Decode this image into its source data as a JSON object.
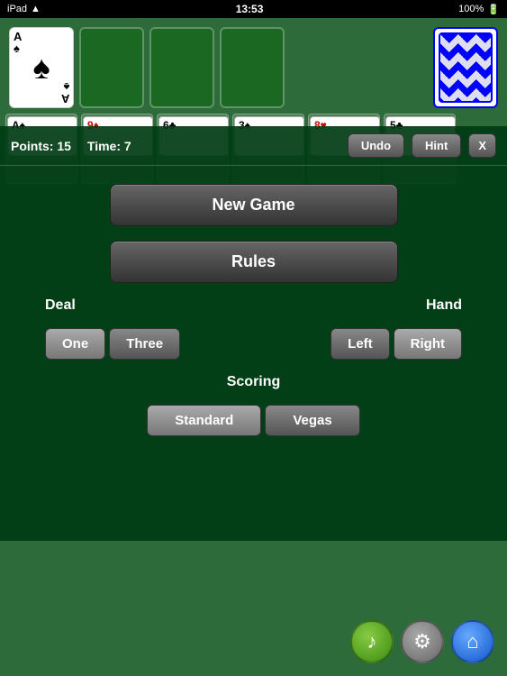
{
  "statusBar": {
    "left": "iPad",
    "time": "13:53",
    "right": "100%"
  },
  "gameArea": {
    "foundations": [
      {
        "label": "A",
        "suit": "♠"
      },
      {
        "label": "",
        "suit": ""
      },
      {
        "label": "",
        "suit": ""
      },
      {
        "label": "",
        "suit": ""
      }
    ],
    "tableauCards": [
      {
        "label": "A♠",
        "red": false
      },
      {
        "label": "9♦",
        "red": true
      },
      {
        "label": "6♣",
        "red": false
      },
      {
        "label": "3♠",
        "red": false
      },
      {
        "label": "8♥",
        "red": true
      },
      {
        "label": "5♣",
        "red": false
      }
    ]
  },
  "overlayBar": {
    "points_label": "Points: 15",
    "time_label": "Time: 7",
    "undo_label": "Undo",
    "hint_label": "Hint",
    "close_label": "X"
  },
  "menu": {
    "new_game_label": "New Game",
    "rules_label": "Rules",
    "deal_label": "Deal",
    "hand_label": "Hand",
    "one_label": "One",
    "three_label": "Three",
    "left_label": "Left",
    "right_label": "Right",
    "scoring_label": "Scoring",
    "standard_label": "Standard",
    "vegas_label": "Vegas"
  },
  "bottomButtons": {
    "music_icon": "♪",
    "wrench_icon": "⚙",
    "home_icon": "⌂"
  }
}
